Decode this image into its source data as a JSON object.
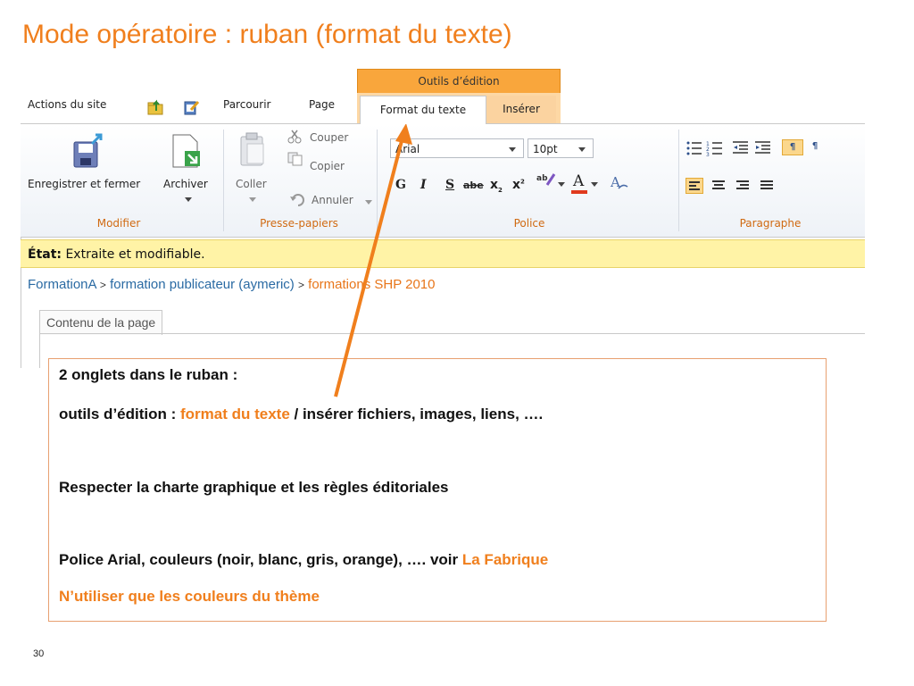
{
  "slide": {
    "title": "Mode opératoire : ruban (format du texte)",
    "page_number": "30"
  },
  "tabbar": {
    "site_actions": "Actions du site",
    "contextual_group": "Outils d’édition",
    "tabs": [
      "Parcourir",
      "Page",
      "Format du texte",
      "Insérer"
    ]
  },
  "ribbon": {
    "groups": {
      "modifier": {
        "label": "Modifier",
        "save_close": "Enregistrer et fermer",
        "archive": "Archiver"
      },
      "clipboard": {
        "label": "Presse-papiers",
        "paste": "Coller",
        "cut": "Couper",
        "copy": "Copier",
        "undo": "Annuler"
      },
      "font": {
        "label": "Police",
        "font_family": "Arial",
        "font_size": "10pt",
        "bold": "G",
        "italic": "I",
        "underline": "S",
        "strike": "abe",
        "subscript": "x",
        "subscript_mark": "2",
        "superscript": "x",
        "superscript_mark": "2",
        "highlight": "ab",
        "font_color": "A"
      },
      "paragraph": {
        "label": "Paragraphe",
        "ltr": "¶",
        "rtl": "¶"
      }
    }
  },
  "status": {
    "label": "État:",
    "value": "Extraite et modifiable."
  },
  "breadcrumb": {
    "root": "FormationA",
    "separator": ">",
    "parent": "formation publicateur (aymeric)",
    "current": "formations SHP 2010"
  },
  "page_tab": "Contenu de la page",
  "note": {
    "line1": "2 onglets dans le ruban :",
    "line2_prefix": "outils d’édition  : ",
    "line2_highlight": "format du texte",
    "line2_suffix": " / insérer fichiers, images, liens, ….",
    "line3": "Respecter la charte graphique et les règles éditoriales",
    "line4_prefix": "Police Arial, couleurs (noir, blanc, gris, orange), …. voir ",
    "line4_link": "La Fabrique",
    "line5": "N’utiliser que les couleurs du thème"
  },
  "colors": {
    "accent_orange": "#f07f1d",
    "context_tab": "#f9a63c",
    "status_bar": "#fff3a6",
    "link_blue": "#2a6aa3"
  },
  "icons": [
    "up-folder-icon",
    "edit-page-icon",
    "save-icon",
    "archive-icon",
    "paste-icon",
    "scissors-icon",
    "copy-icon",
    "undo-icon",
    "highlighter-icon",
    "clear-format-icon",
    "bullets-icon",
    "numbering-icon",
    "decrease-indent-icon",
    "increase-indent-icon",
    "align-left-icon",
    "align-center-icon",
    "align-right-icon",
    "justify-icon"
  ]
}
